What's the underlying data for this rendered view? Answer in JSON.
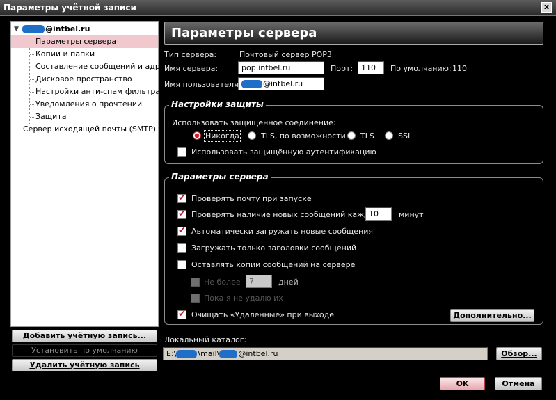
{
  "window": {
    "title": "Параметры учётной записи",
    "close_glyph": "x"
  },
  "tree": {
    "account": {
      "name": "@intbel.ru"
    },
    "items": [
      {
        "label": "Параметры сервера",
        "selected": true
      },
      {
        "label": "Копии и папки"
      },
      {
        "label": "Составление сообщений и адр..."
      },
      {
        "label": "Дисковое пространство"
      },
      {
        "label": "Настройки анти-спам фильтра"
      },
      {
        "label": "Уведомления о прочтении"
      },
      {
        "label": "Защита"
      }
    ],
    "smtp": {
      "label": "Сервер исходящей почты (SMTP)"
    }
  },
  "side_buttons": {
    "add_account": "Добавить учётную запись...",
    "set_default": "Установить по умолчанию",
    "delete_account": "Удалить учётную запись"
  },
  "panel": {
    "header": "Параметры сервера",
    "server_type_label": "Тип сервера:",
    "server_type_value": "Почтовый сервер POP3",
    "server_name_label": "Имя сервера:",
    "server_name_value": "pop.intbel.ru",
    "port_label": "Порт:",
    "port_value": "110",
    "default_label": "По умолчанию:",
    "default_value": "110",
    "username_label": "Имя пользователя:",
    "username_value": "@intbel.ru"
  },
  "security": {
    "title": "Настройки защиты",
    "connection_label": "Использовать защищённое соединение:",
    "options": [
      "Никогда",
      "TLS, по возможности",
      "TLS",
      "SSL"
    ],
    "selected_option": "Никогда",
    "secure_auth_label": "Использовать защищённую аутентификацию",
    "secure_auth_checked": false
  },
  "server_settings": {
    "title": "Параметры сервера",
    "check_on_startup": "Проверять почту при запуске",
    "check_every": "Проверять наличие новых сообщений каждые",
    "check_every_value": "10",
    "minutes": "минут",
    "auto_download": "Автоматически загружать новые сообщения",
    "headers_only": "Загружать только заголовки сообщений",
    "leave_copies": "Оставлять копии сообщений на сервере",
    "no_more_than": "Не более",
    "no_more_than_value": "7",
    "days": "дней",
    "until_deleted": "Пока я не удалю их",
    "empty_trash": "Очищать «Удалённые» при выходе",
    "advanced_button": "Дополнительно..."
  },
  "local_dir": {
    "label": "Локальный каталог:",
    "path_prefix": "E:\\",
    "path_mid": "\\mail\\",
    "path_suffix": "@intbel.ru",
    "browse_button": "Обзор..."
  },
  "footer": {
    "ok": "OK",
    "cancel": "Отмена"
  },
  "colors": {
    "accent": "#b5202c",
    "selection": "#f1c8cd",
    "redaction": "#1f6fc9"
  }
}
